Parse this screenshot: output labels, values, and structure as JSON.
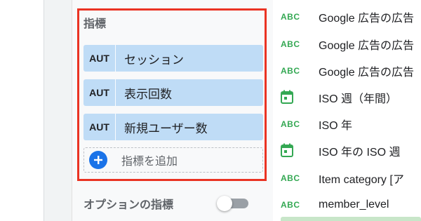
{
  "metrics_section": {
    "title": "指標",
    "metrics": [
      {
        "tag": "AUT",
        "label": "セッション"
      },
      {
        "tag": "AUT",
        "label": "表示回数"
      },
      {
        "tag": "AUT",
        "label": "新規ユーザー数"
      }
    ],
    "add_label": "指標を追加"
  },
  "optional_metrics": {
    "label": "オプションの指標",
    "enabled": false
  },
  "fields": [
    {
      "type": "ABC",
      "icon": "text-type-icon",
      "label": "Google 広告の広告"
    },
    {
      "type": "ABC",
      "icon": "text-type-icon",
      "label": "Google 広告の広告"
    },
    {
      "type": "ABC",
      "icon": "text-type-icon",
      "label": "Google 広告の広告"
    },
    {
      "type": "",
      "icon": "calendar-icon",
      "label": "ISO 週（年間）"
    },
    {
      "type": "ABC",
      "icon": "text-type-icon",
      "label": "ISO 年"
    },
    {
      "type": "",
      "icon": "calendar-icon",
      "label": "ISO 年の ISO 週"
    },
    {
      "type": "ABC",
      "icon": "text-type-icon",
      "label": "Item category [ア"
    },
    {
      "type": "ABC",
      "icon": "text-type-icon",
      "label": "member_level"
    }
  ],
  "colors": {
    "highlight": "#ea3323",
    "chip": "#bfdcf6",
    "add_icon": "#1a73e8",
    "field_type": "#34a853"
  }
}
